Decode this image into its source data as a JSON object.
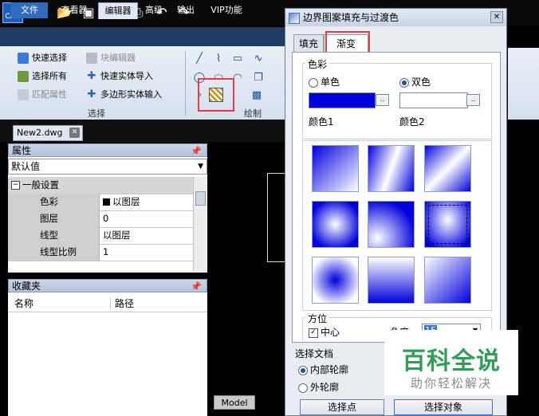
{
  "app": {
    "logo_text": "CAD"
  },
  "toolbar": {
    "icons": [
      "new-icon",
      "open-icon",
      "save-icon",
      "pdf-save-icon",
      "print-icon",
      "undo-icon",
      "redo-icon"
    ]
  },
  "menu": {
    "tabs": [
      "文件",
      "查看器",
      "编辑器",
      "高级",
      "输出",
      "VIP功能"
    ],
    "active": "编辑器"
  },
  "ribbon": {
    "select_group": {
      "label": "选择",
      "items": [
        {
          "label": "快速选择",
          "enabled": true
        },
        {
          "label": "块编辑器",
          "enabled": false
        },
        {
          "label": "选择所有",
          "enabled": true
        },
        {
          "label": "快速实体导入",
          "enabled": true
        },
        {
          "label": "匹配属性",
          "enabled": false
        },
        {
          "label": "多边形实体输入",
          "enabled": true
        }
      ]
    },
    "draw_group": {
      "label": "绘制",
      "highlighted_tool": "hatch-icon"
    }
  },
  "document_tab": {
    "label": "New2.dwg"
  },
  "properties": {
    "title": "属性",
    "dropdown_value": "默认值",
    "section": "一般设置",
    "rows": [
      {
        "key": "色彩",
        "value": "以图层"
      },
      {
        "key": "图层",
        "value": "0"
      },
      {
        "key": "线型",
        "value": "以图层"
      },
      {
        "key": "线型比例",
        "value": "1"
      }
    ]
  },
  "favorites": {
    "title": "收藏夹",
    "columns": [
      "名称",
      "路径"
    ]
  },
  "canvas": {
    "model_tab": "Model"
  },
  "dialog": {
    "title": "边界图案填充与过渡色",
    "tabs": [
      "填充",
      "渐变"
    ],
    "active_tab": "渐变",
    "color_section": {
      "label": "色彩",
      "single": "单色",
      "double": "双色",
      "selected": "双色",
      "color1_label": "颜色1",
      "color2_label": "颜色2",
      "color1": "#0000dd",
      "color2": "#ffffff",
      "dots": ".."
    },
    "orientation": {
      "label": "方位",
      "center_label": "中心",
      "center_checked": true,
      "angle_label": "角度",
      "angle_value": "15"
    },
    "boundary": {
      "label": "选择文档",
      "inner": "内部轮廓",
      "outer": "外轮廓",
      "selected": "内部轮廓"
    },
    "buttons": {
      "pick_points": "选择点",
      "select_objects": "选择对象"
    }
  },
  "watermark": {
    "title": "百科全说",
    "subtitle": "助你轻松解决"
  }
}
